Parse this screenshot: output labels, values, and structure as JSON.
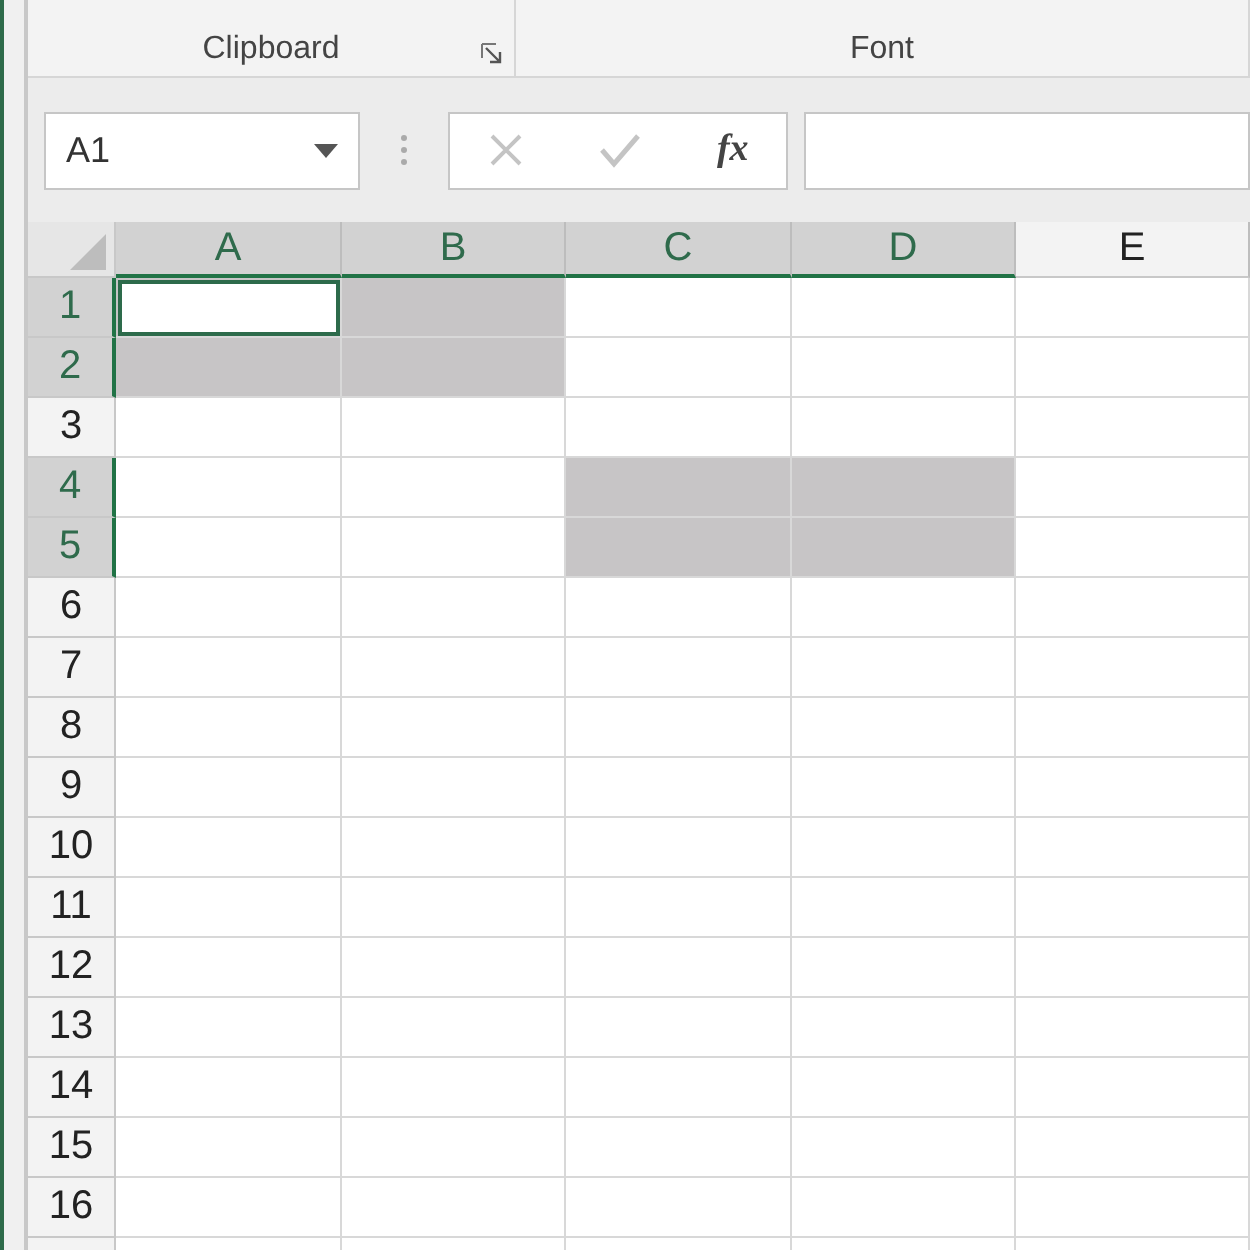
{
  "ribbon_groups": [
    {
      "label": "Clipboard",
      "launcher": true
    },
    {
      "label": "Font",
      "launcher": false
    }
  ],
  "name_box": {
    "value": "A1"
  },
  "formula_bar": {
    "function_label": "fx"
  },
  "columns": [
    {
      "label": "A",
      "selected": true
    },
    {
      "label": "B",
      "selected": true
    },
    {
      "label": "C",
      "selected": true
    },
    {
      "label": "D",
      "selected": true
    },
    {
      "label": "E",
      "selected": false
    }
  ],
  "rows": [
    {
      "label": "1",
      "selected": true,
      "cells": [
        {
          "selected": true,
          "active": true
        },
        {
          "selected": true,
          "active": false
        },
        {
          "selected": false,
          "active": false
        },
        {
          "selected": false,
          "active": false
        },
        {
          "selected": false,
          "active": false
        }
      ]
    },
    {
      "label": "2",
      "selected": true,
      "cells": [
        {
          "selected": true,
          "active": false
        },
        {
          "selected": true,
          "active": false
        },
        {
          "selected": false,
          "active": false
        },
        {
          "selected": false,
          "active": false
        },
        {
          "selected": false,
          "active": false
        }
      ]
    },
    {
      "label": "3",
      "selected": false,
      "cells": [
        {
          "selected": false,
          "active": false
        },
        {
          "selected": false,
          "active": false
        },
        {
          "selected": false,
          "active": false
        },
        {
          "selected": false,
          "active": false
        },
        {
          "selected": false,
          "active": false
        }
      ]
    },
    {
      "label": "4",
      "selected": true,
      "cells": [
        {
          "selected": false,
          "active": false
        },
        {
          "selected": false,
          "active": false
        },
        {
          "selected": true,
          "active": false
        },
        {
          "selected": true,
          "active": false
        },
        {
          "selected": false,
          "active": false
        }
      ]
    },
    {
      "label": "5",
      "selected": true,
      "cells": [
        {
          "selected": false,
          "active": false
        },
        {
          "selected": false,
          "active": false
        },
        {
          "selected": true,
          "active": false
        },
        {
          "selected": true,
          "active": false
        },
        {
          "selected": false,
          "active": false
        }
      ]
    },
    {
      "label": "6",
      "selected": false,
      "cells": [
        {
          "selected": false,
          "active": false
        },
        {
          "selected": false,
          "active": false
        },
        {
          "selected": false,
          "active": false
        },
        {
          "selected": false,
          "active": false
        },
        {
          "selected": false,
          "active": false
        }
      ]
    },
    {
      "label": "7",
      "selected": false,
      "cells": [
        {
          "selected": false,
          "active": false
        },
        {
          "selected": false,
          "active": false
        },
        {
          "selected": false,
          "active": false
        },
        {
          "selected": false,
          "active": false
        },
        {
          "selected": false,
          "active": false
        }
      ]
    },
    {
      "label": "8",
      "selected": false,
      "cells": [
        {
          "selected": false,
          "active": false
        },
        {
          "selected": false,
          "active": false
        },
        {
          "selected": false,
          "active": false
        },
        {
          "selected": false,
          "active": false
        },
        {
          "selected": false,
          "active": false
        }
      ]
    },
    {
      "label": "9",
      "selected": false,
      "cells": [
        {
          "selected": false,
          "active": false
        },
        {
          "selected": false,
          "active": false
        },
        {
          "selected": false,
          "active": false
        },
        {
          "selected": false,
          "active": false
        },
        {
          "selected": false,
          "active": false
        }
      ]
    },
    {
      "label": "10",
      "selected": false,
      "cells": [
        {
          "selected": false,
          "active": false
        },
        {
          "selected": false,
          "active": false
        },
        {
          "selected": false,
          "active": false
        },
        {
          "selected": false,
          "active": false
        },
        {
          "selected": false,
          "active": false
        }
      ]
    },
    {
      "label": "11",
      "selected": false,
      "cells": [
        {
          "selected": false,
          "active": false
        },
        {
          "selected": false,
          "active": false
        },
        {
          "selected": false,
          "active": false
        },
        {
          "selected": false,
          "active": false
        },
        {
          "selected": false,
          "active": false
        }
      ]
    },
    {
      "label": "12",
      "selected": false,
      "cells": [
        {
          "selected": false,
          "active": false
        },
        {
          "selected": false,
          "active": false
        },
        {
          "selected": false,
          "active": false
        },
        {
          "selected": false,
          "active": false
        },
        {
          "selected": false,
          "active": false
        }
      ]
    },
    {
      "label": "13",
      "selected": false,
      "cells": [
        {
          "selected": false,
          "active": false
        },
        {
          "selected": false,
          "active": false
        },
        {
          "selected": false,
          "active": false
        },
        {
          "selected": false,
          "active": false
        },
        {
          "selected": false,
          "active": false
        }
      ]
    },
    {
      "label": "14",
      "selected": false,
      "cells": [
        {
          "selected": false,
          "active": false
        },
        {
          "selected": false,
          "active": false
        },
        {
          "selected": false,
          "active": false
        },
        {
          "selected": false,
          "active": false
        },
        {
          "selected": false,
          "active": false
        }
      ]
    },
    {
      "label": "15",
      "selected": false,
      "cells": [
        {
          "selected": false,
          "active": false
        },
        {
          "selected": false,
          "active": false
        },
        {
          "selected": false,
          "active": false
        },
        {
          "selected": false,
          "active": false
        },
        {
          "selected": false,
          "active": false
        }
      ]
    },
    {
      "label": "16",
      "selected": false,
      "cells": [
        {
          "selected": false,
          "active": false
        },
        {
          "selected": false,
          "active": false
        },
        {
          "selected": false,
          "active": false
        },
        {
          "selected": false,
          "active": false
        },
        {
          "selected": false,
          "active": false
        }
      ]
    }
  ]
}
